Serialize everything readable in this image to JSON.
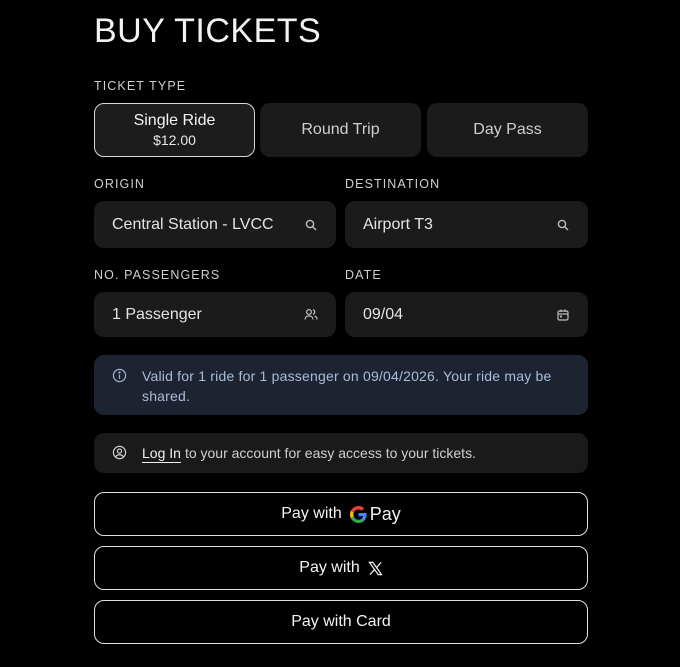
{
  "title": "BUY TICKETS",
  "ticket_type": {
    "label": "TICKET TYPE",
    "options": [
      {
        "label": "Single Ride",
        "price": "$12.00",
        "selected": true
      },
      {
        "label": "Round Trip",
        "selected": false
      },
      {
        "label": "Day Pass",
        "selected": false
      }
    ]
  },
  "origin": {
    "label": "ORIGIN",
    "value": "Central Station - LVCC",
    "icon": "search-icon"
  },
  "destination": {
    "label": "DESTINATION",
    "value": "Airport T3",
    "icon": "search-icon"
  },
  "passengers": {
    "label": "NO. PASSENGERS",
    "value": "1 Passenger",
    "icon": "users-icon"
  },
  "date": {
    "label": "DATE",
    "value": "09/04",
    "icon": "calendar-icon"
  },
  "info": {
    "text": "Valid for 1 ride for 1 passenger on 09/04/2026. Your ride may be shared.",
    "icon": "info-icon"
  },
  "login": {
    "link": "Log In",
    "text": "to your account for easy access to your tickets.",
    "icon": "user-circle-icon"
  },
  "payment": {
    "google_pay": {
      "prefix": "Pay with",
      "brand": "Pay"
    },
    "x_pay": {
      "prefix": "Pay with"
    },
    "card": {
      "label": "Pay with Card"
    }
  },
  "colors": {
    "background": "#000000",
    "info_bg": "#1d2330",
    "info_text": "#a9bcdc"
  }
}
